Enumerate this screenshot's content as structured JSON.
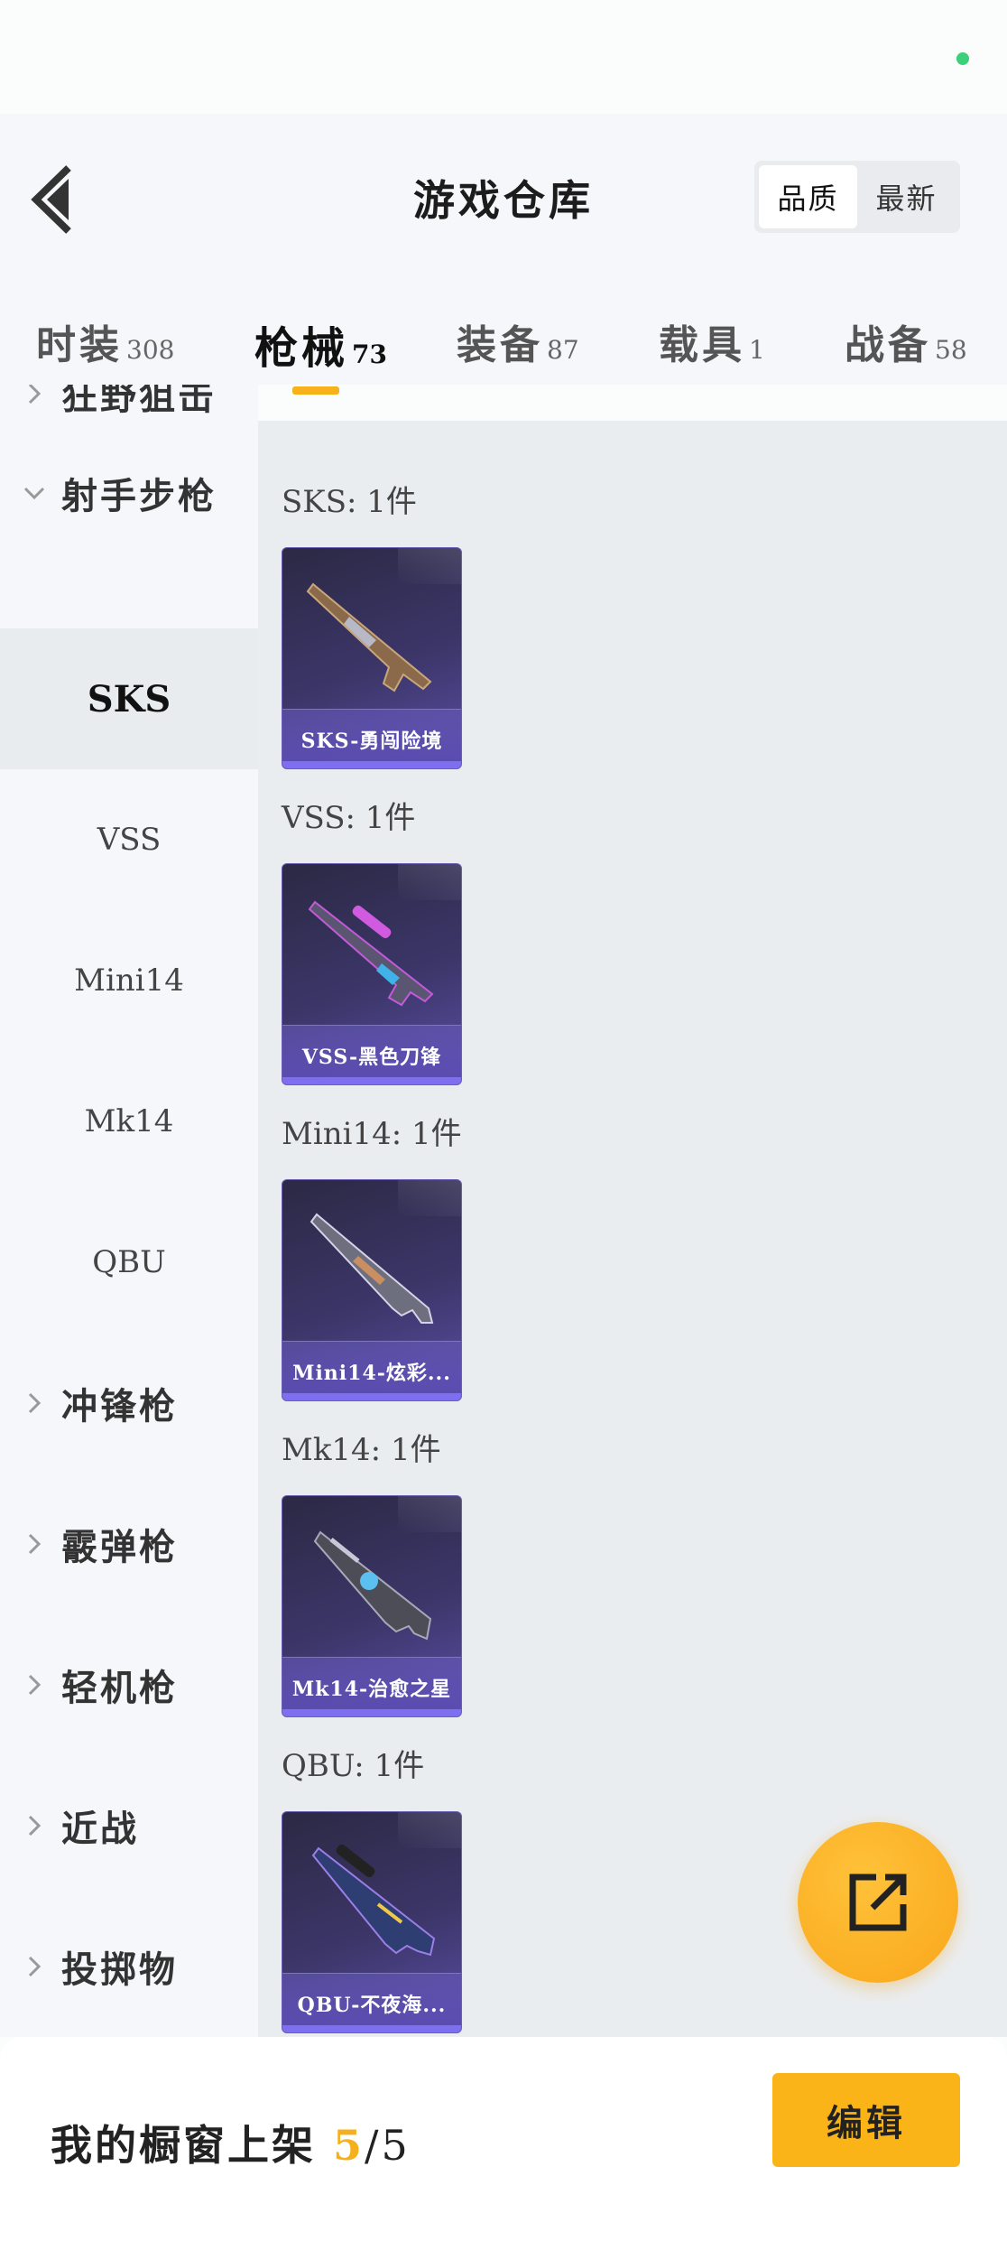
{
  "header": {
    "title": "游戏仓库",
    "sort_options": [
      "品质",
      "最新"
    ],
    "active_sort": "品质"
  },
  "tabs": [
    {
      "label": "时装",
      "count": "308"
    },
    {
      "label": "枪械",
      "count": "73"
    },
    {
      "label": "装备",
      "count": "87"
    },
    {
      "label": "载具",
      "count": "1"
    },
    {
      "label": "战备",
      "count": "58"
    }
  ],
  "active_tab": "枪械",
  "sidebar": {
    "partial_item": "狂野狙击",
    "groups": [
      {
        "label": "射手步枪",
        "expanded": true
      },
      {
        "label": "冲锋枪"
      },
      {
        "label": "霰弹枪"
      },
      {
        "label": "轻机枪"
      },
      {
        "label": "近战"
      },
      {
        "label": "投掷物"
      }
    ],
    "sub_items": [
      "SKS",
      "VSS",
      "Mini14",
      "Mk14",
      "QBU"
    ],
    "active_sub_item": "SKS"
  },
  "sections": [
    {
      "title": "SKS: 1件",
      "item_name": "SKS-勇闯险境"
    },
    {
      "title": "VSS: 1件",
      "item_name": "VSS-黑色刀锋"
    },
    {
      "title": "Mini14: 1件",
      "item_name": "Mini14-炫彩..."
    },
    {
      "title": "Mk14: 1件",
      "item_name": "Mk14-治愈之星"
    },
    {
      "title": "QBU: 1件",
      "item_name": "QBU-不夜海..."
    }
  ],
  "footer": {
    "label": "我的橱窗上架",
    "listed": "5",
    "separator": "/",
    "max": "5",
    "edit_label": "编辑"
  },
  "colors": {
    "accent": "#f9b11b",
    "card_purple": "#5a4bb0"
  },
  "icons": [
    "back-arrow-icon",
    "chevron-right-icon",
    "chevron-down-icon",
    "share-external-icon"
  ]
}
